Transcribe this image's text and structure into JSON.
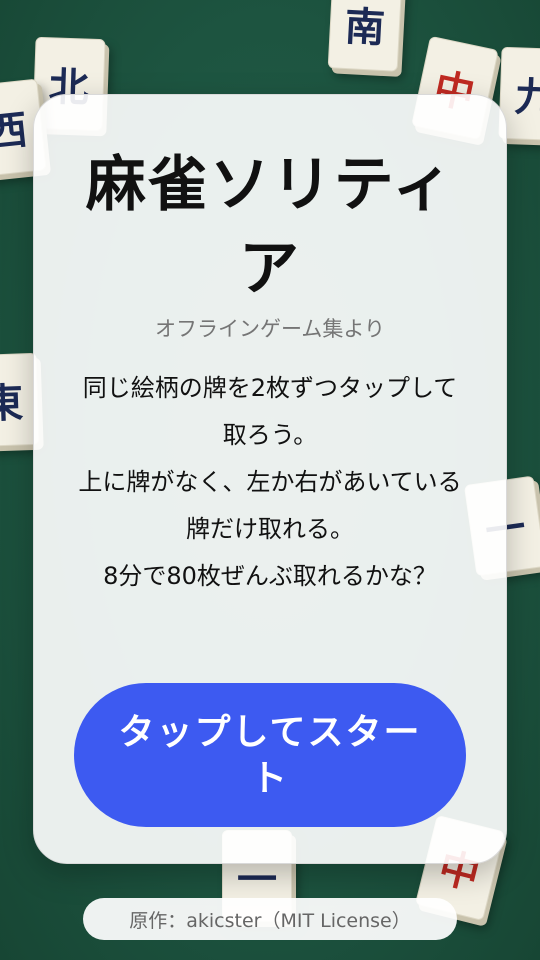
{
  "title": "麻雀ソリティア",
  "subtitle": "オフラインゲーム集より",
  "instructions": [
    "同じ絵柄の牌を2枚ずつタップして取ろう。",
    "上に牌がなく、左か右があいている牌だけ取れる。",
    "8分で80枚ぜんぶ取れるかな？"
  ],
  "start_button_label": "タップしてスタート",
  "credit": "原作：akicster（MIT License）",
  "background_tiles": [
    {
      "glyph": "南",
      "color": "navy"
    },
    {
      "glyph": "北",
      "color": "navy"
    },
    {
      "glyph": "西",
      "color": "navy"
    },
    {
      "glyph": "中",
      "color": "red"
    },
    {
      "glyph": "九",
      "color": "navy"
    },
    {
      "glyph": "東",
      "color": "navy"
    },
    {
      "glyph": "一",
      "color": "navy"
    },
    {
      "glyph": "中",
      "color": "red"
    },
    {
      "glyph": "一",
      "color": "navy"
    }
  ]
}
